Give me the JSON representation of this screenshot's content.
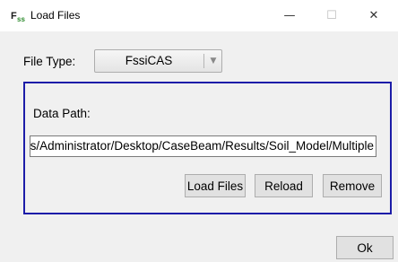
{
  "window": {
    "title": "Load Files",
    "minimize_glyph": "—",
    "maximize_glyph": "☐",
    "close_glyph": "✕"
  },
  "file_type": {
    "label": "File Type:",
    "selected": "FssiCAS"
  },
  "data_path": {
    "label": "Data Path:",
    "value": "C:/Users/Administrator/Desktop/CaseBeam/Results/Soil_Model/Multiple"
  },
  "buttons": {
    "load_files": "Load Files",
    "reload": "Reload",
    "remove": "Remove",
    "ok": "Ok"
  },
  "colors": {
    "group_border": "#1c1ca8",
    "background": "#f0f0f0"
  }
}
